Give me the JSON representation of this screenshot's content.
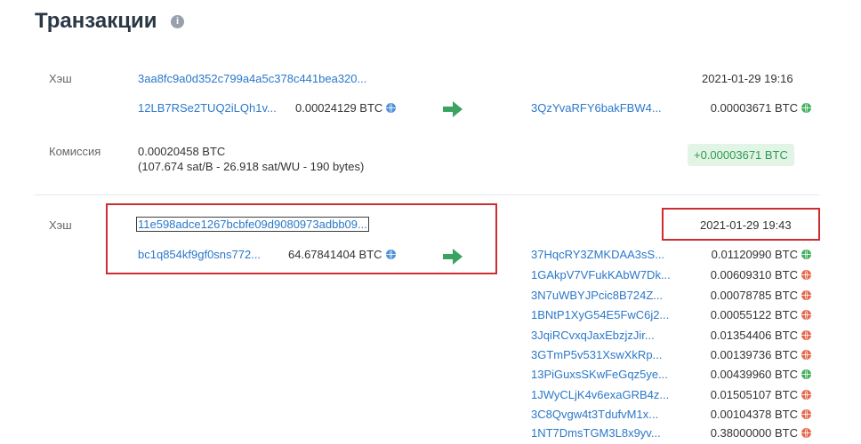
{
  "header": {
    "title": "Транзакции",
    "info_icon": "i"
  },
  "transactions": [
    {
      "hash_label": "Хэш",
      "hash": "3aa8fc9a0d352c799a4a5c378c441bea320...",
      "time": "2021-01-29 19:16",
      "input": {
        "address": "12LB7RSe2TUQ2iLQh1v...",
        "amount": "0.00024129 BTC"
      },
      "outputs": [
        {
          "address": "3QzYvaRFY6bakFBW4...",
          "amount": "0.00003671 BTC",
          "status": "green"
        }
      ],
      "fee_label": "Комиссия",
      "fee": "0.00020458 BTC",
      "fee_detail": "(107.674 sat/B - 26.918 sat/WU - 190 bytes)",
      "balance_change": "+0.00003671 BTC"
    },
    {
      "hash_label": "Хэш",
      "hash": "11e598adce1267bcbfe09d9080973adbb09...",
      "time": "2021-01-29 19:43",
      "input": {
        "address": "bc1q854kf9gf0sns772...",
        "amount": "64.67841404 BTC"
      },
      "outputs": [
        {
          "address": "37HqcRY3ZMKDAA3sS...",
          "amount": "0.01120990 BTC",
          "status": "green"
        },
        {
          "address": "1GAkpV7VFukKAbW7Dk...",
          "amount": "0.00609310 BTC",
          "status": "red"
        },
        {
          "address": "3N7uWBYJPcic8B724Z...",
          "amount": "0.00078785 BTC",
          "status": "red"
        },
        {
          "address": "1BNtP1XyG54E5FwC6j2...",
          "amount": "0.00055122 BTC",
          "status": "red"
        },
        {
          "address": "3JqiRCvxqJaxEbzjzJir...",
          "amount": "0.01354406 BTC",
          "status": "red"
        },
        {
          "address": "3GTmP5v531XswXkRp...",
          "amount": "0.00139736 BTC",
          "status": "red"
        },
        {
          "address": "13PiGuxsSKwFeGqz5ye...",
          "amount": "0.00439960 BTC",
          "status": "green"
        },
        {
          "address": "1JWyCLjK4v6exaGRB4z...",
          "amount": "0.01505107 BTC",
          "status": "red"
        },
        {
          "address": "3C8Qvgw4t3TdufvM1x...",
          "amount": "0.00104378 BTC",
          "status": "red"
        },
        {
          "address": "1NT7DmsTGM3L8x9yv...",
          "amount": "0.38000000 BTC",
          "status": "red"
        }
      ]
    }
  ],
  "colors": {
    "link": "#2b78c9",
    "highlight_box": "#cc2d30",
    "arrow": "#3aa35f",
    "badge_bg": "#e2f4e6",
    "badge_text": "#2e9a4f"
  },
  "icons": {
    "input_status": "globe-icon",
    "arrow": "arrow-right-icon"
  }
}
